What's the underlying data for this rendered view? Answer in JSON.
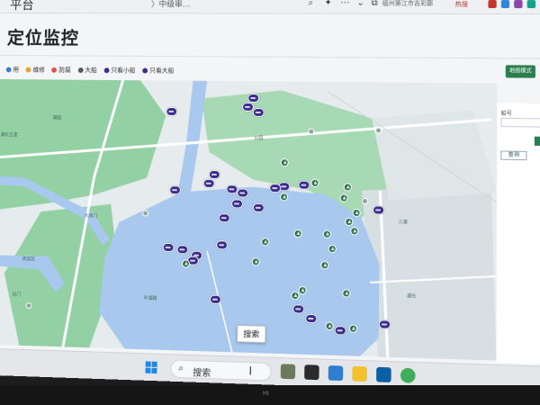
{
  "browser": {
    "app_title": "平台",
    "tab_label": "〉中级审…",
    "search_placeholder": "福州第江市吉彩鄭",
    "quick_link": "热搜",
    "icons": [
      "search-icon",
      "star-icon",
      "chevron-down-icon",
      "more-icon",
      "restore-icon"
    ]
  },
  "page": {
    "title": "定位监控",
    "mode_button": "地图模式"
  },
  "legend": {
    "items": [
      {
        "label": "用",
        "color": "#3a7bd5"
      },
      {
        "label": "维修",
        "color": "#f0a020"
      },
      {
        "label": "防腐",
        "color": "#e05050"
      },
      {
        "label": "大船",
        "color": "#555555"
      },
      {
        "label": "只看小船",
        "color": "#3a2d8a"
      },
      {
        "label": "只看大船",
        "color": "#3a2d8a"
      }
    ]
  },
  "right_panel": {
    "label": "船号",
    "button": "查询"
  },
  "map": {
    "labels": [
      "潮红五里",
      "潮园",
      "大西门",
      "荷泉区",
      "石门",
      "公园",
      "三浦",
      "湖光",
      "环湖路"
    ],
    "colors": {
      "water": "#a8c8ee",
      "park": "#93d1a5",
      "road": "#ffffff",
      "land": "#e6ecee"
    }
  },
  "tooltip": "搜索",
  "taskbar": {
    "search_label": "搜索",
    "cursor_glyph": "I",
    "apps": [
      "widgets-icon",
      "task-view-icon",
      "mail-icon",
      "folder-icon",
      "store-icon",
      "edge-icon"
    ]
  },
  "bezel": {
    "brand": "MI"
  }
}
